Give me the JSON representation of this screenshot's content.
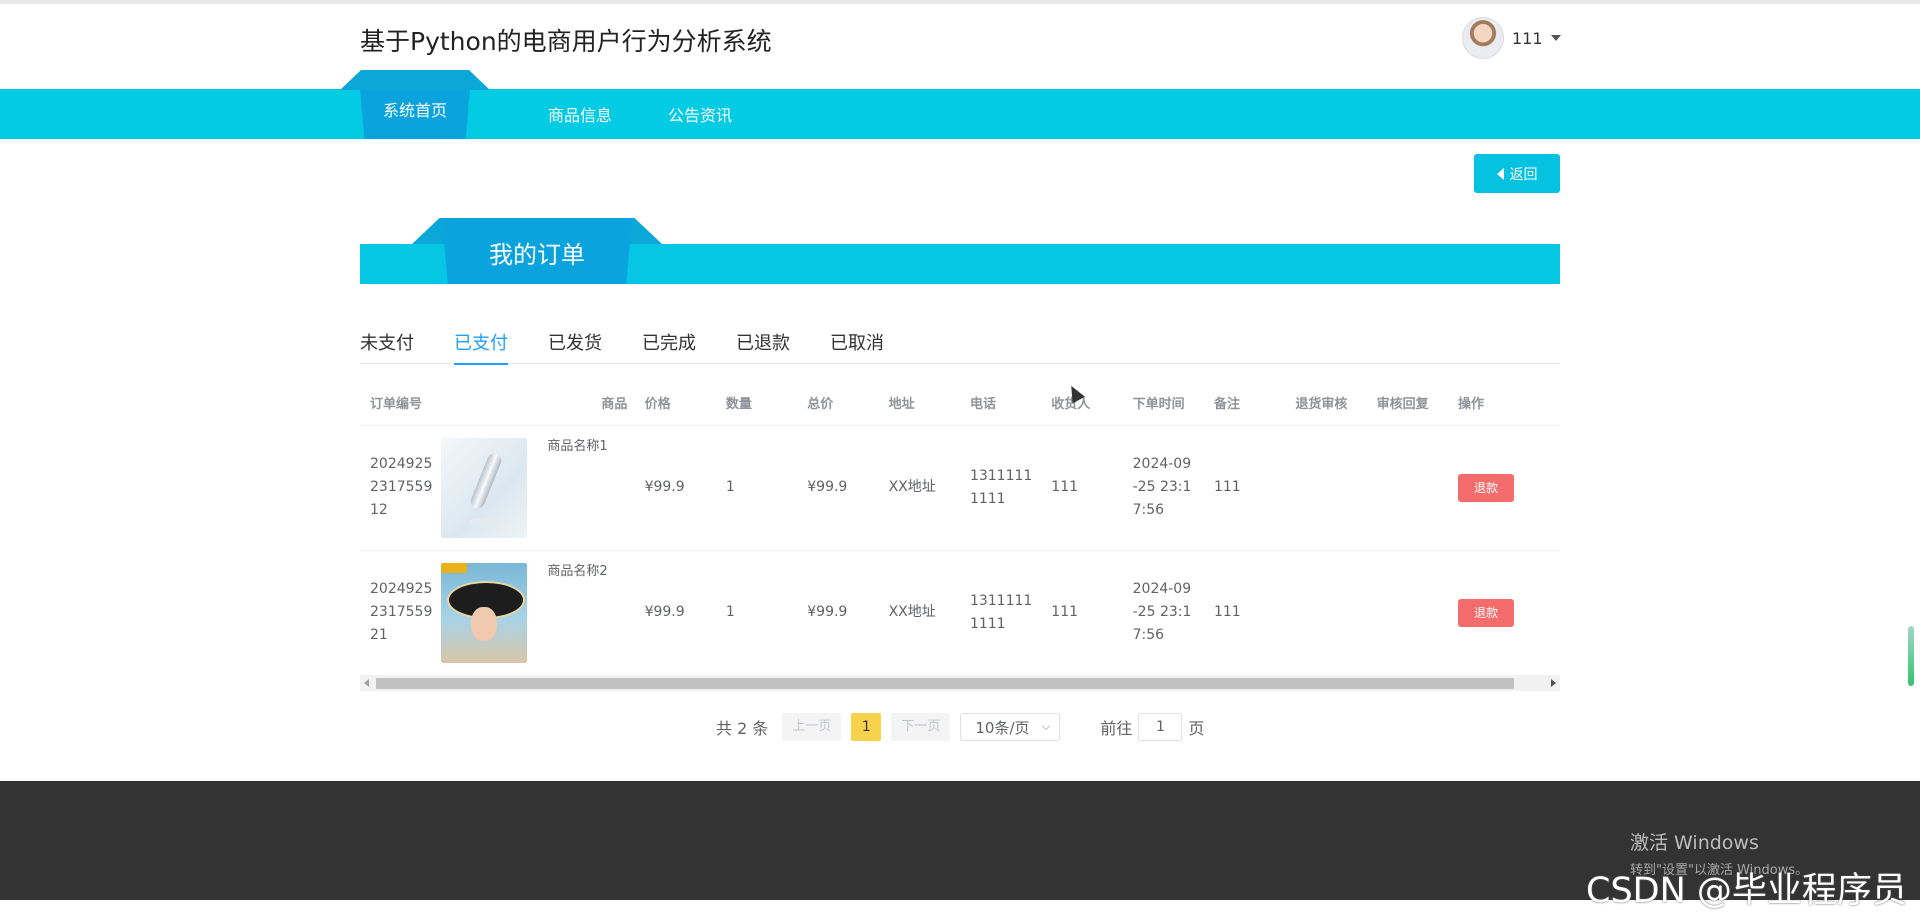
{
  "header": {
    "site_title": "基于Python的电商用户行为分析系统",
    "user_name": "111"
  },
  "nav": {
    "items": [
      {
        "label": "系统首页",
        "active": true
      },
      {
        "label": "商品信息",
        "active": false
      },
      {
        "label": "公告资讯",
        "active": false
      }
    ]
  },
  "back_button": {
    "label": "返回"
  },
  "section": {
    "title": "我的订单"
  },
  "status_tabs": [
    {
      "label": "未支付",
      "active": false
    },
    {
      "label": "已支付",
      "active": true
    },
    {
      "label": "已发货",
      "active": false
    },
    {
      "label": "已完成",
      "active": false
    },
    {
      "label": "已退款",
      "active": false
    },
    {
      "label": "已取消",
      "active": false
    }
  ],
  "table": {
    "columns": [
      "订单编号",
      "商品",
      "价格",
      "数量",
      "总价",
      "地址",
      "电话",
      "收货人",
      "下单时间",
      "备注",
      "退货审核",
      "审核回复",
      "操作"
    ],
    "rows": [
      {
        "order_no": "20249252317559 12",
        "order_no_lines": [
          "2024925",
          "2317559",
          "12"
        ],
        "product_name": "商品名称1",
        "price": "¥99.9",
        "quantity": "1",
        "total": "¥99.9",
        "address": "XX地址",
        "phone_lines": [
          "1311111",
          "1111"
        ],
        "receiver": "111",
        "time_lines": [
          "2024-09",
          "-25 23:1",
          "7:56"
        ],
        "remark": "111",
        "return_review": "",
        "review_reply": "",
        "action": "退款"
      },
      {
        "order_no": "20249252317559 21",
        "order_no_lines": [
          "2024925",
          "2317559",
          "21"
        ],
        "product_name": "商品名称2",
        "price": "¥99.9",
        "quantity": "1",
        "total": "¥99.9",
        "address": "XX地址",
        "phone_lines": [
          "1311111",
          "1111"
        ],
        "receiver": "111",
        "time_lines": [
          "2024-09",
          "-25 23:1",
          "7:56"
        ],
        "remark": "111",
        "return_review": "",
        "review_reply": "",
        "action": "退款"
      }
    ]
  },
  "pagination": {
    "total_text": "共 2 条",
    "prev_label": "上一页",
    "current_page": "1",
    "next_label": "下一页",
    "page_size": "10条/页",
    "goto_prefix": "前往",
    "goto_value": "1",
    "goto_suffix": "页"
  },
  "overlay": {
    "windows_activate_title": "激活 Windows",
    "windows_activate_sub": "转到\"设置\"以激活 Windows。",
    "watermark": "CSDN @毕业程序员"
  },
  "colors": {
    "nav_bar": "#03cbe4",
    "active_tab": "#0ba3de",
    "status_active": "#1e9fff",
    "refund_button": "#f56c6c",
    "page_current": "#f8d24a",
    "footer": "#333333"
  }
}
